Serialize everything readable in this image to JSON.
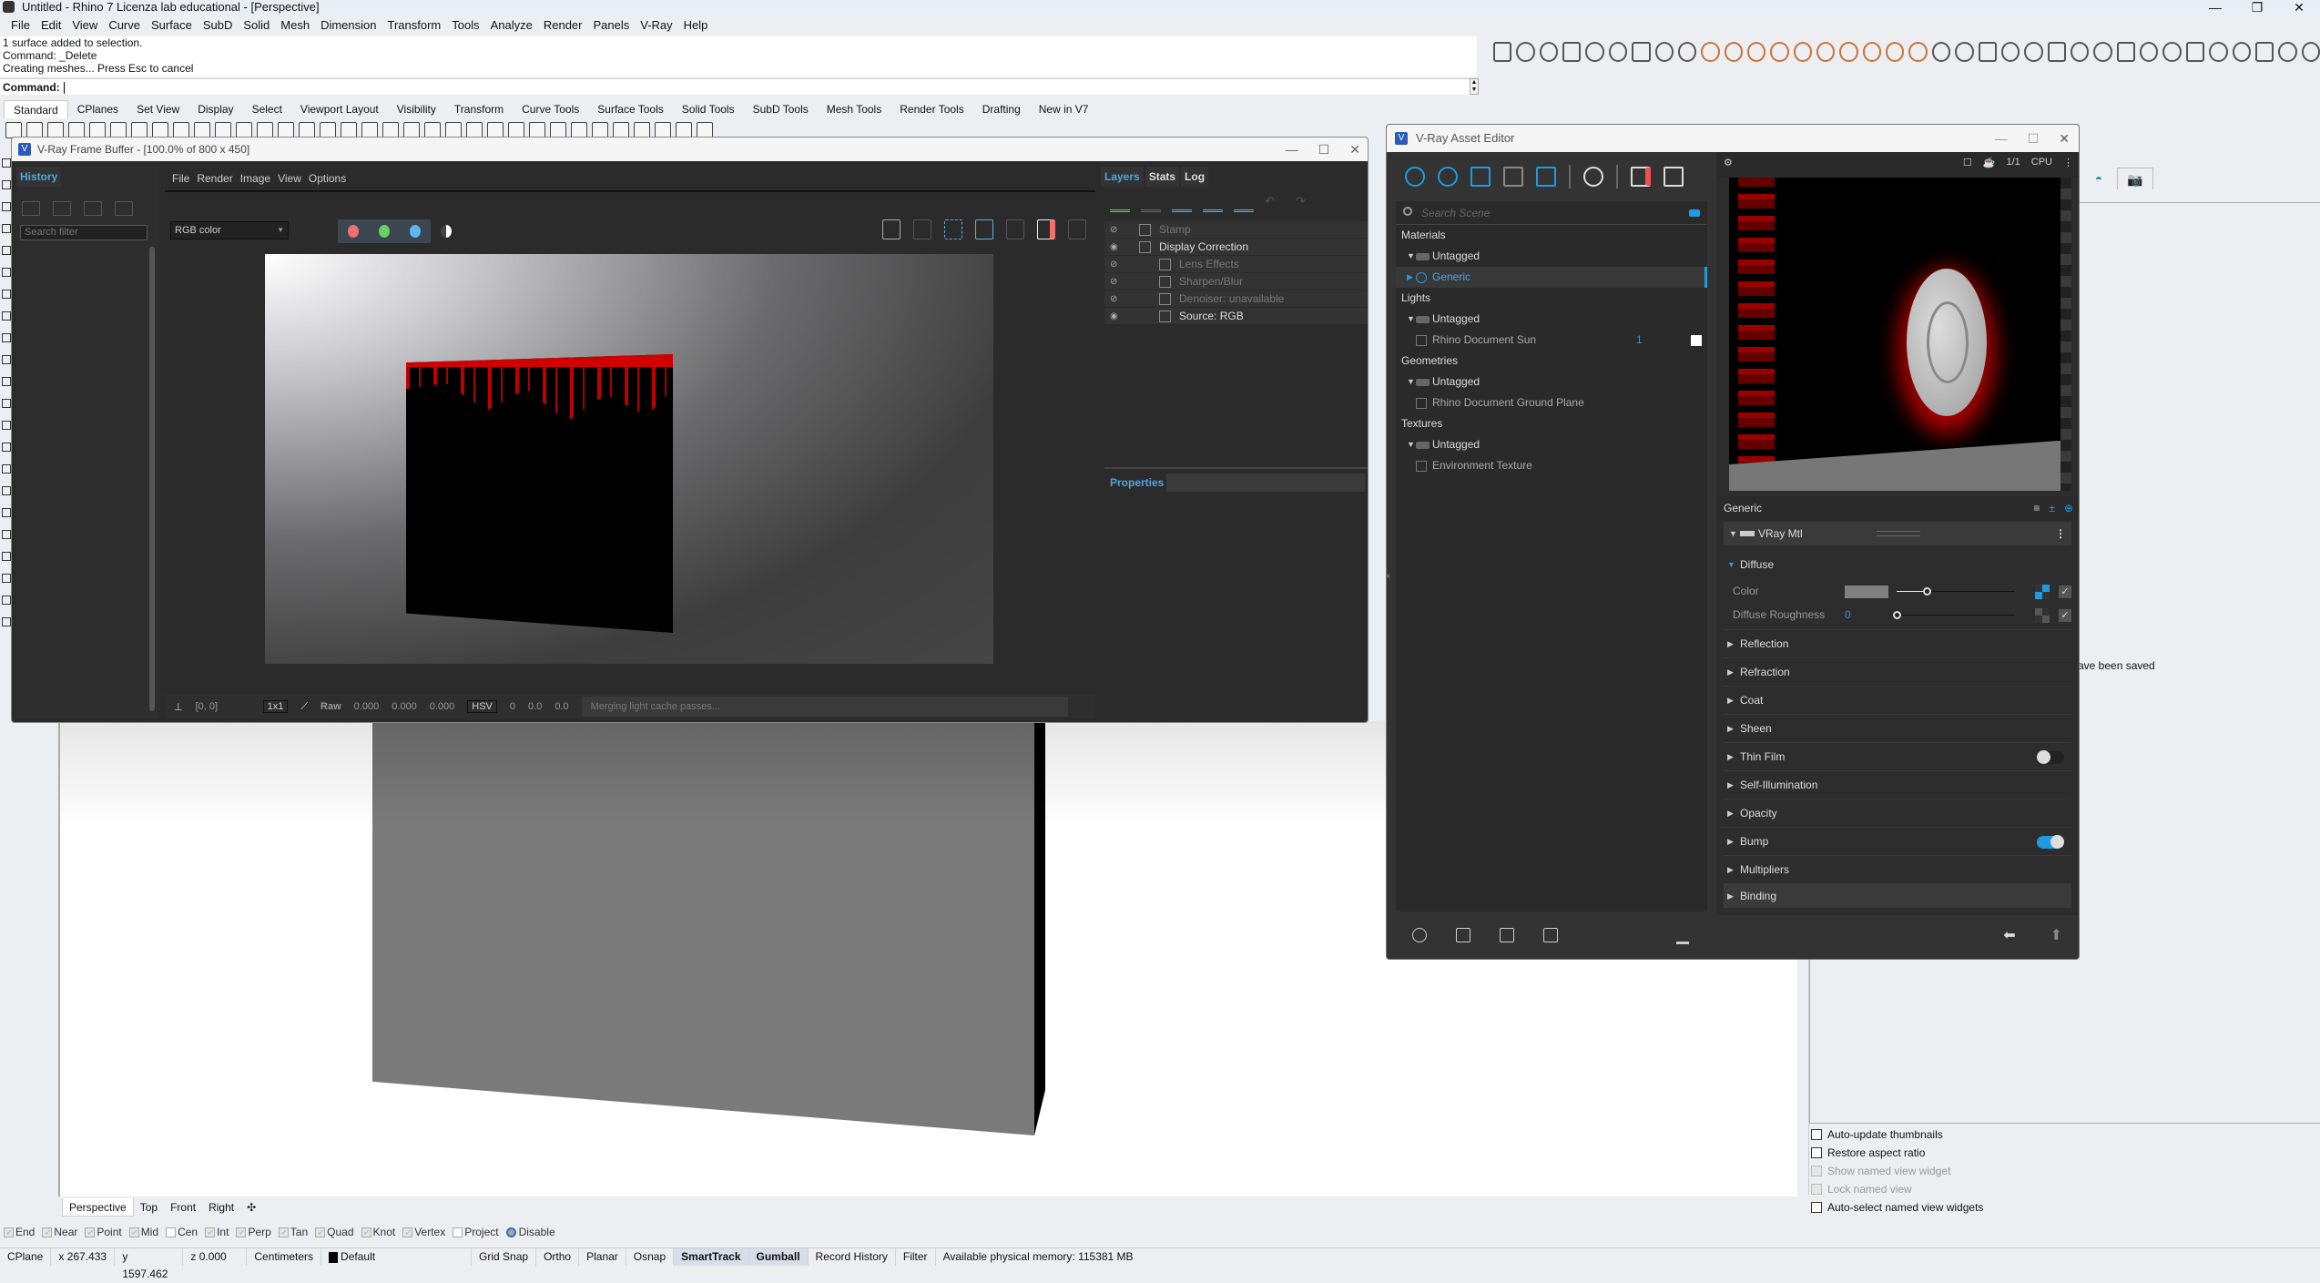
{
  "window": {
    "title": "Untitled - Rhino 7 Licenza lab educational - [Perspective]",
    "controls": {
      "minimize": "—",
      "restore": "❐",
      "close": "✕"
    }
  },
  "menubar": [
    "File",
    "Edit",
    "View",
    "Curve",
    "Surface",
    "SubD",
    "Solid",
    "Mesh",
    "Dimension",
    "Transform",
    "Tools",
    "Analyze",
    "Render",
    "Panels",
    "V-Ray",
    "Help"
  ],
  "command_history": [
    "1 surface added to selection.",
    "Command: _Delete",
    "Creating meshes... Press Esc to cancel"
  ],
  "command_prompt": {
    "label": "Command:",
    "value": ""
  },
  "toolbar_tabs": {
    "items": [
      "Standard",
      "CPlanes",
      "Set View",
      "Display",
      "Select",
      "Viewport Layout",
      "Visibility",
      "Transform",
      "Curve Tools",
      "Surface Tools",
      "Solid Tools",
      "SubD Tools",
      "Mesh Tools",
      "Render Tools",
      "Drafting",
      "New in V7"
    ],
    "active": "Standard"
  },
  "viewport_tabs": {
    "items": [
      "Perspective",
      "Top",
      "Front",
      "Right"
    ],
    "add": "✣",
    "active": "Perspective"
  },
  "osnap": {
    "items": [
      {
        "label": "End",
        "checked": true
      },
      {
        "label": "Near",
        "checked": true
      },
      {
        "label": "Point",
        "checked": true
      },
      {
        "label": "Mid",
        "checked": true
      },
      {
        "label": "Cen",
        "checked": false
      },
      {
        "label": "Int",
        "checked": true
      },
      {
        "label": "Perp",
        "checked": true
      },
      {
        "label": "Tan",
        "checked": true
      },
      {
        "label": "Quad",
        "checked": true
      },
      {
        "label": "Knot",
        "checked": true
      },
      {
        "label": "Vertex",
        "checked": true
      },
      {
        "label": "Project",
        "checked": false
      }
    ],
    "disable_label": "Disable"
  },
  "statusbar": {
    "cplane": "CPlane",
    "x": "x 267.433",
    "y": "y 1597.462",
    "z": "z 0.000",
    "units": "Centimeters",
    "layer": "Default",
    "toggles": [
      {
        "label": "Grid Snap",
        "on": false
      },
      {
        "label": "Ortho",
        "on": false
      },
      {
        "label": "Planar",
        "on": false
      },
      {
        "label": "Osnap",
        "on": false
      },
      {
        "label": "SmartTrack",
        "on": true
      },
      {
        "label": "Gumball",
        "on": true
      },
      {
        "label": "Record History",
        "on": false
      },
      {
        "label": "Filter",
        "on": false
      }
    ],
    "memory": "Available physical memory: 115381 MB"
  },
  "right_panel": {
    "saved_text": "ave been saved",
    "options": [
      {
        "label": "Auto-update thumbnails",
        "enabled": true,
        "checked": false
      },
      {
        "label": "Restore aspect ratio",
        "enabled": true,
        "checked": false
      },
      {
        "label": "Show named view widget",
        "enabled": false,
        "checked": false
      },
      {
        "label": "Lock named view",
        "enabled": false,
        "checked": false
      },
      {
        "label": "Auto-select named view widgets",
        "enabled": true,
        "checked": false
      }
    ]
  },
  "vfb": {
    "title": "V-Ray Frame Buffer - [100.0% of 800 x 450]",
    "history_tab": "History",
    "search_placeholder": "Search filter",
    "menu": [
      "File",
      "Render",
      "Image",
      "View",
      "Options"
    ],
    "channel": "RGB color",
    "channel_colors": {
      "red": "#f07070",
      "green": "#66d066",
      "blue": "#5ab8f0"
    },
    "bottom": {
      "coords": "[0, 0]",
      "zoom": "1x1",
      "raw_label": "Raw",
      "raw_values": [
        "0.000",
        "0.000",
        "0.000"
      ],
      "color_mode": "HSV",
      "hsv_values": [
        "0",
        "0.0",
        "0.0"
      ],
      "status": "Merging light cache passes..."
    },
    "layer_tabs": [
      "Layers",
      "Stats",
      "Log"
    ],
    "layers": [
      {
        "name": "Stamp",
        "visible": false,
        "indent": 0
      },
      {
        "name": "Display Correction",
        "visible": true,
        "indent": 0
      },
      {
        "name": "Lens Effects",
        "visible": false,
        "indent": 1
      },
      {
        "name": "Sharpen/Blur",
        "visible": false,
        "indent": 1
      },
      {
        "name": "Denoiser: unavailable",
        "visible": false,
        "indent": 1
      },
      {
        "name": "Source: RGB",
        "visible": true,
        "indent": 1
      }
    ],
    "properties_label": "Properties"
  },
  "asset_editor": {
    "title": "V-Ray Asset Editor",
    "search_placeholder": "Search Scene",
    "categories": [
      {
        "name": "Materials",
        "groups": [
          {
            "name": "Untagged",
            "items": [
              {
                "name": "Generic",
                "selected": true
              }
            ]
          }
        ]
      },
      {
        "name": "Lights",
        "groups": [
          {
            "name": "Untagged",
            "items": [
              {
                "name": "Rhino Document Sun",
                "count": "1"
              }
            ]
          }
        ]
      },
      {
        "name": "Geometries",
        "groups": [
          {
            "name": "Untagged",
            "items": [
              {
                "name": "Rhino Document Ground Plane"
              }
            ]
          }
        ]
      },
      {
        "name": "Textures",
        "groups": [
          {
            "name": "Untagged",
            "items": [
              {
                "name": "Environment Texture"
              }
            ]
          }
        ]
      }
    ],
    "preview": {
      "ratio": "1/1",
      "engine": "CPU"
    },
    "material_name": "Generic",
    "material_type": "VRay Mtl",
    "diffuse": {
      "label": "Diffuse",
      "color_label": "Color",
      "color_value": "#808080",
      "color_slider": 0.25,
      "roughness_label": "Diffuse Roughness",
      "roughness_value": "0",
      "roughness_slider": 0.0
    },
    "sections": [
      {
        "label": "Reflection"
      },
      {
        "label": "Refraction"
      },
      {
        "label": "Coat"
      },
      {
        "label": "Sheen"
      },
      {
        "label": "Thin Film",
        "toggle": false
      },
      {
        "label": "Self-Illumination"
      },
      {
        "label": "Opacity"
      },
      {
        "label": "Bump",
        "toggle": true
      },
      {
        "label": "Multipliers"
      },
      {
        "label": "Binding"
      }
    ]
  }
}
